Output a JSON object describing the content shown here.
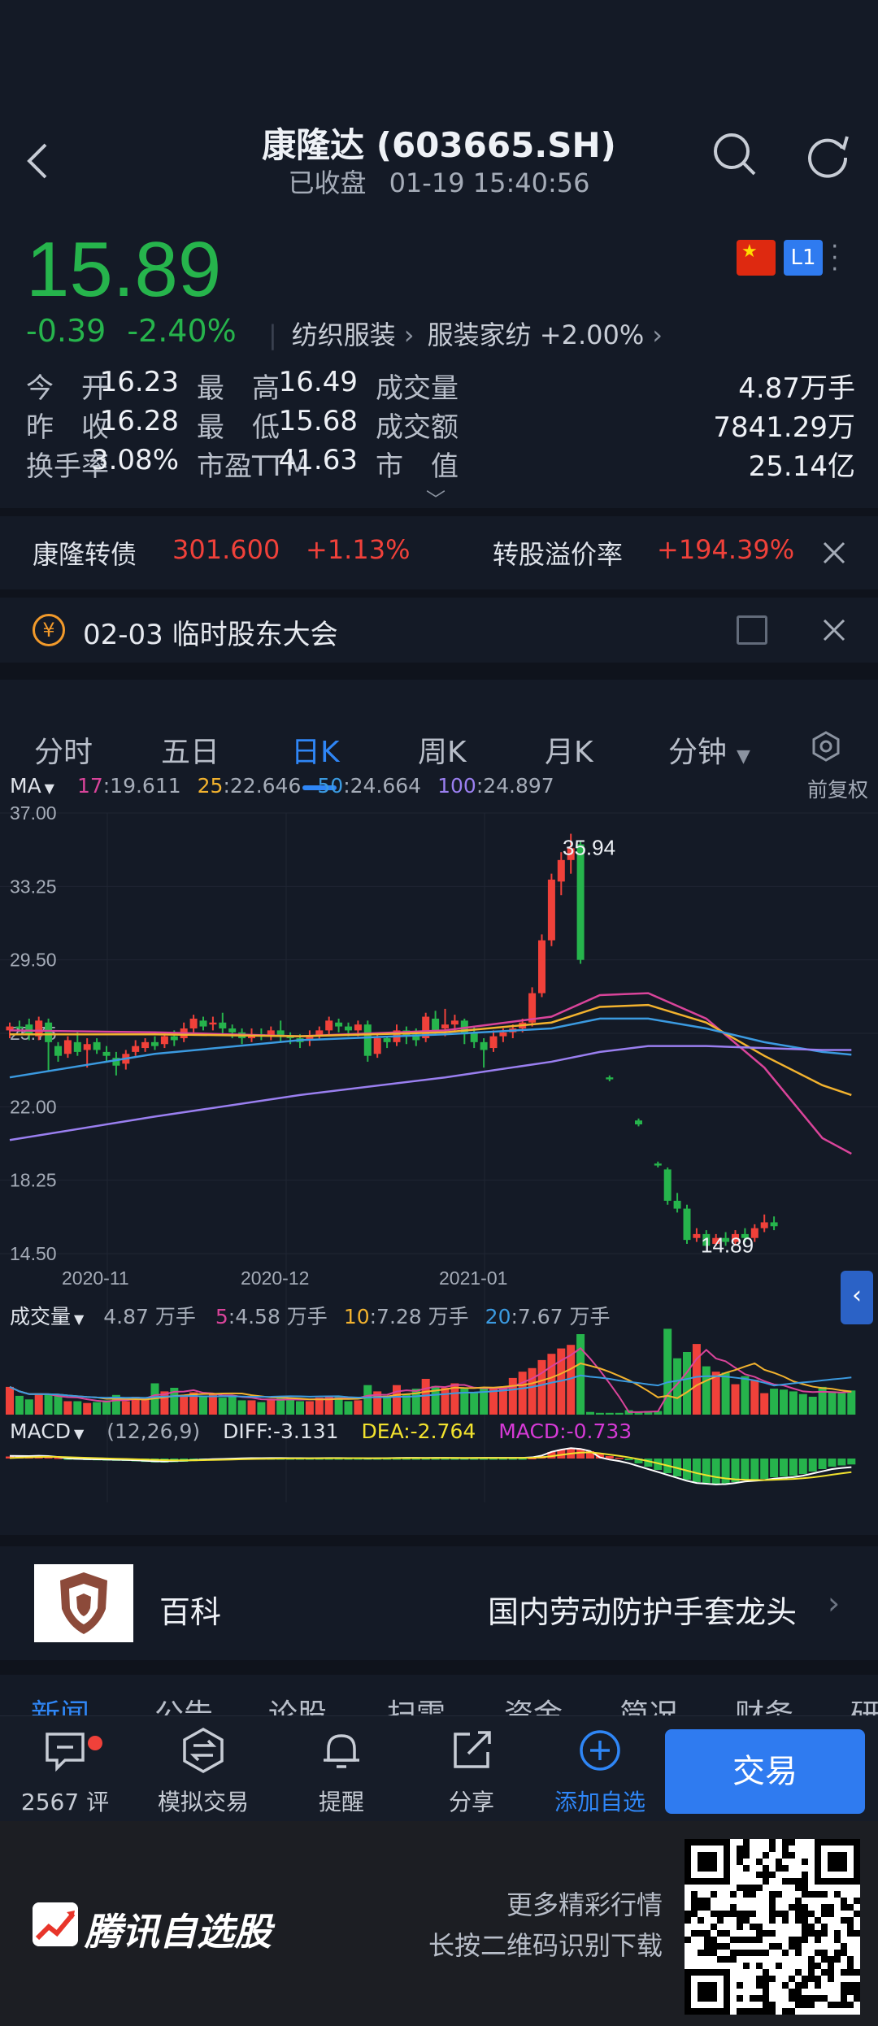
{
  "header": {
    "title": "康隆达 (603665.SH)",
    "status": "已收盘",
    "datetime": "01-19 15:40:56"
  },
  "quote": {
    "price": "15.89",
    "change": "-0.39",
    "change_pct": "-2.40%",
    "industry": "纺织服装",
    "subsector": "服装家纺",
    "subsector_change": "+2.00%",
    "level_badge": "L1",
    "stats": [
      {
        "label": "今　开",
        "value": "16.23"
      },
      {
        "label": "最　高",
        "value": "16.49"
      },
      {
        "label": "成交量",
        "value": "4.87万手"
      },
      {
        "label": "昨　收",
        "value": "16.28"
      },
      {
        "label": "最　低",
        "value": "15.68"
      },
      {
        "label": "成交额",
        "value": "7841.29万"
      },
      {
        "label": "换手率",
        "value": "3.08%"
      },
      {
        "label": "市盈TTM",
        "value": "41.63"
      },
      {
        "label": "市　值",
        "value": "25.14亿"
      }
    ]
  },
  "bond": {
    "name": "康隆转债",
    "price": "301.600",
    "change": "+1.13%",
    "premium_label": "转股溢价率",
    "premium_value": "+194.39%"
  },
  "event": {
    "coin": "¥",
    "text": "02-03 临时股东大会"
  },
  "tabs": {
    "items": [
      "分时",
      "五日",
      "日K",
      "周K",
      "月K",
      "分钟"
    ],
    "active": "日K"
  },
  "ma_legend": {
    "name": "MA",
    "items": [
      {
        "k": "17",
        "v": "19.611",
        "color": "#d9449a"
      },
      {
        "k": "25",
        "v": "22.646",
        "color": "#f2b22e"
      },
      {
        "k": "50",
        "v": "24.664",
        "color": "#3b9ae0"
      },
      {
        "k": "100",
        "v": "24.897",
        "color": "#9a7ff0"
      }
    ],
    "adjust": "前复权"
  },
  "volume_legend": {
    "name": "成交量",
    "current": "4.87 万手",
    "items": [
      {
        "k": "5",
        "v": "4.58 万手",
        "color": "#d9449a"
      },
      {
        "k": "10",
        "v": "7.28 万手",
        "color": "#f2b22e"
      },
      {
        "k": "20",
        "v": "7.67 万手",
        "color": "#3b9ae0"
      }
    ]
  },
  "macd_legend": {
    "name": "MACD",
    "params": "(12,26,9)",
    "diff": "DIFF:-3.131",
    "dea": "DEA:-2.764",
    "macd": "MACD:-0.733"
  },
  "chart_data": {
    "type": "candlestick",
    "y_ticks": [
      "37.00",
      "33.25",
      "29.50",
      "25.75",
      "22.00",
      "18.25",
      "14.50"
    ],
    "ylim": [
      14.5,
      37.0
    ],
    "x_ticks": [
      "2020-11",
      "2020-12",
      "2021-01"
    ],
    "high_label": "35.94",
    "low_label": "14.89",
    "candles": [
      [
        25.9,
        26.1,
        25.5,
        26.3
      ],
      [
        26.1,
        26.0,
        25.8,
        26.4
      ],
      [
        26.2,
        25.7,
        25.4,
        26.5
      ],
      [
        25.6,
        26.4,
        25.4,
        26.6
      ],
      [
        26.3,
        25.3,
        23.8,
        26.5
      ],
      [
        25.1,
        24.6,
        24.3,
        25.3
      ],
      [
        24.7,
        25.4,
        24.5,
        25.6
      ],
      [
        25.3,
        24.8,
        24.6,
        25.8
      ],
      [
        24.9,
        25.2,
        24.0,
        25.5
      ],
      [
        25.3,
        24.9,
        24.7,
        25.5
      ],
      [
        24.8,
        24.6,
        24.3,
        25.1
      ],
      [
        24.5,
        24.1,
        23.6,
        24.8
      ],
      [
        24.2,
        24.7,
        23.9,
        24.9
      ],
      [
        24.8,
        25.1,
        24.6,
        25.4
      ],
      [
        25.0,
        25.3,
        24.8,
        25.5
      ],
      [
        25.3,
        25.1,
        24.9,
        25.6
      ],
      [
        25.2,
        25.6,
        25.0,
        25.8
      ],
      [
        25.6,
        25.4,
        25.1,
        25.9
      ],
      [
        25.5,
        26.0,
        25.3,
        26.3
      ],
      [
        26.0,
        26.5,
        25.8,
        26.7
      ],
      [
        26.4,
        26.1,
        25.9,
        26.6
      ],
      [
        26.2,
        26.3,
        25.9,
        26.6
      ],
      [
        26.3,
        26.0,
        25.7,
        26.8
      ],
      [
        26.0,
        25.8,
        25.5,
        26.2
      ],
      [
        25.8,
        25.5,
        25.2,
        26.0
      ],
      [
        25.5,
        25.7,
        25.3,
        26.0
      ],
      [
        25.7,
        25.6,
        25.4,
        26.0
      ],
      [
        25.6,
        25.9,
        25.4,
        26.1
      ],
      [
        25.9,
        25.6,
        25.3,
        26.4
      ],
      [
        25.6,
        25.5,
        25.2,
        25.8
      ],
      [
        25.5,
        25.3,
        25.0,
        25.7
      ],
      [
        25.4,
        25.6,
        25.1,
        25.9
      ],
      [
        25.6,
        25.9,
        25.4,
        26.1
      ],
      [
        25.9,
        26.4,
        25.7,
        26.6
      ],
      [
        26.3,
        26.1,
        25.8,
        26.5
      ],
      [
        26.1,
        25.9,
        25.6,
        26.3
      ],
      [
        25.9,
        26.2,
        25.6,
        26.4
      ],
      [
        26.2,
        24.6,
        24.3,
        26.4
      ],
      [
        24.7,
        25.5,
        24.5,
        25.7
      ],
      [
        25.5,
        25.3,
        25.0,
        25.6
      ],
      [
        25.3,
        25.9,
        25.1,
        26.2
      ],
      [
        25.9,
        25.6,
        25.2,
        26.1
      ],
      [
        25.7,
        25.4,
        25.1,
        26.0
      ],
      [
        25.5,
        26.6,
        25.3,
        26.8
      ],
      [
        26.5,
        25.9,
        25.7,
        26.9
      ],
      [
        26.0,
        26.2,
        25.6,
        27.0
      ],
      [
        26.2,
        26.4,
        25.8,
        26.7
      ],
      [
        26.4,
        25.7,
        25.2,
        26.5
      ],
      [
        25.8,
        25.3,
        25.0,
        26.1
      ],
      [
        25.3,
        24.9,
        24.0,
        25.5
      ],
      [
        25.0,
        25.6,
        24.8,
        25.9
      ],
      [
        25.6,
        25.8,
        25.3,
        26.0
      ],
      [
        25.8,
        26.0,
        25.5,
        26.2
      ],
      [
        26.0,
        26.3,
        25.8,
        26.5
      ],
      [
        26.3,
        27.8,
        26.1,
        28.1
      ],
      [
        27.8,
        30.5,
        27.6,
        30.8
      ],
      [
        30.5,
        33.6,
        30.2,
        33.9
      ],
      [
        33.5,
        34.6,
        32.8,
        35.0
      ],
      [
        34.6,
        35.2,
        33.9,
        35.94
      ],
      [
        35.4,
        29.5,
        29.3,
        35.6
      ],
      [
        null
      ],
      [
        null
      ],
      [
        23.5,
        23.4,
        23.3,
        23.6
      ],
      [
        null
      ],
      [
        null
      ],
      [
        21.3,
        21.1,
        21.0,
        21.4
      ],
      [
        null
      ],
      [
        19.1,
        19.0,
        18.9,
        19.2
      ],
      [
        18.8,
        17.2,
        17.0,
        18.9
      ],
      [
        17.2,
        16.8,
        16.6,
        17.6
      ],
      [
        16.8,
        15.2,
        15.0,
        17.0
      ],
      [
        15.3,
        15.5,
        15.1,
        15.8
      ],
      [
        15.5,
        14.9,
        14.89,
        15.7
      ],
      [
        15.0,
        15.3,
        14.9,
        15.5
      ],
      [
        15.3,
        15.1,
        14.9,
        15.6
      ],
      [
        15.1,
        15.5,
        14.95,
        15.7
      ],
      [
        15.5,
        15.3,
        15.1,
        15.8
      ],
      [
        15.3,
        15.8,
        15.1,
        16.0
      ],
      [
        15.8,
        16.1,
        15.6,
        16.5
      ],
      [
        16.1,
        15.9,
        15.7,
        16.4
      ]
    ],
    "ma_series": [
      {
        "name": "MA17",
        "color": "#d9449a",
        "values": [
          [
            0,
            25.9
          ],
          [
            15,
            25.8
          ],
          [
            30,
            25.6
          ],
          [
            45,
            25.9
          ],
          [
            56,
            26.6
          ],
          [
            61,
            27.7
          ],
          [
            66,
            27.8
          ],
          [
            72,
            26.5
          ],
          [
            78,
            24.0
          ],
          [
            84,
            20.4
          ],
          [
            87,
            19.6
          ]
        ]
      },
      {
        "name": "MA25",
        "color": "#f2b22e",
        "values": [
          [
            0,
            25.7
          ],
          [
            15,
            25.7
          ],
          [
            30,
            25.6
          ],
          [
            45,
            25.8
          ],
          [
            56,
            26.3
          ],
          [
            61,
            27.1
          ],
          [
            66,
            27.2
          ],
          [
            72,
            26.3
          ],
          [
            78,
            24.6
          ],
          [
            84,
            23.1
          ],
          [
            87,
            22.6
          ]
        ]
      },
      {
        "name": "MA50",
        "color": "#3b9ae0",
        "values": [
          [
            0,
            23.5
          ],
          [
            15,
            24.7
          ],
          [
            30,
            25.4
          ],
          [
            45,
            25.7
          ],
          [
            56,
            26.0
          ],
          [
            61,
            26.5
          ],
          [
            66,
            26.5
          ],
          [
            72,
            26.0
          ],
          [
            78,
            25.3
          ],
          [
            84,
            24.8
          ],
          [
            87,
            24.66
          ]
        ]
      },
      {
        "name": "MA100",
        "color": "#9a7ff0",
        "values": [
          [
            0,
            20.3
          ],
          [
            15,
            21.5
          ],
          [
            30,
            22.6
          ],
          [
            45,
            23.5
          ],
          [
            56,
            24.3
          ],
          [
            61,
            24.8
          ],
          [
            66,
            25.1
          ],
          [
            72,
            25.1
          ],
          [
            78,
            25.0
          ],
          [
            84,
            24.9
          ],
          [
            87,
            24.9
          ]
        ]
      }
    ],
    "volume": [
      3.1,
      2.1,
      1.7,
      2.3,
      2.2,
      2.1,
      1.5,
      1.5,
      1.3,
      1.4,
      1.6,
      2.2,
      1.5,
      2.0,
      1.7,
      3.5,
      2.6,
      3.0,
      2.1,
      2.5,
      2.0,
      2.3,
      1.9,
      2.1,
      1.6,
      1.6,
      1.4,
      1.7,
      2.0,
      1.8,
      1.5,
      1.5,
      1.9,
      2.1,
      2.1,
      1.5,
      1.6,
      3.3,
      2.6,
      2.1,
      3.3,
      2.3,
      2.9,
      4.0,
      3.2,
      3.0,
      3.5,
      2.9,
      2.5,
      2.9,
      3.0,
      3.1,
      4.1,
      4.8,
      5.2,
      6.1,
      6.8,
      7.4,
      7.8,
      9.0,
      0.3,
      0.2,
      0.2,
      0.2,
      0.5,
      0.3,
      0.4,
      0.4,
      9.6,
      6.3,
      7.0,
      7.9,
      5.4,
      4.8,
      4.7,
      3.4,
      4.3,
      3.9,
      2.4,
      2.9,
      2.8,
      2.6,
      2.3,
      2.0,
      3.1,
      2.6,
      2.4,
      2.7
    ],
    "macd_hist": [
      0.25,
      0.24,
      0.22,
      0.26,
      0.22,
      0.1,
      -0.1,
      -0.15,
      -0.2,
      -0.22,
      -0.25,
      -0.28,
      -0.3,
      -0.35,
      -0.42,
      -0.48,
      -0.5,
      -0.45,
      -0.4,
      -0.32,
      -0.25,
      -0.2,
      -0.16,
      -0.12,
      -0.08,
      -0.06,
      -0.05,
      -0.04,
      -0.04,
      -0.05,
      -0.06,
      -0.07,
      -0.05,
      -0.04,
      -0.04,
      -0.05,
      -0.06,
      -0.08,
      -0.07,
      -0.05,
      -0.03,
      -0.02,
      -0.02,
      -0.03,
      -0.02,
      -0.02,
      -0.03,
      -0.04,
      -0.03,
      -0.02,
      -0.02,
      -0.01,
      -0.01,
      -0.01,
      0.05,
      0.3,
      0.8,
      1.1,
      1.3,
      1.2,
      0.9,
      0.6,
      0.3,
      0.1,
      -0.2,
      -0.6,
      -1.0,
      -1.4,
      -1.8,
      -2.2,
      -2.6,
      -2.9,
      -3.0,
      -3.1,
      -3.05,
      -2.9,
      -2.7,
      -2.6,
      -2.5,
      -2.3,
      -2.2,
      -2.1,
      -1.9,
      -1.6,
      -1.3,
      -1.0,
      -0.85,
      -0.73
    ]
  },
  "baike": {
    "label": "百科",
    "text": "国内劳动防护手套龙头"
  },
  "news_tabs": [
    "新闻",
    "公告",
    "论股",
    "扫雷",
    "资金",
    "简况",
    "财务",
    "研"
  ],
  "bottom_nav": [
    {
      "label": "2567 评",
      "icon": "comment-icon"
    },
    {
      "label": "模拟交易",
      "icon": "exchange-icon"
    },
    {
      "label": "提醒",
      "icon": "bell-icon"
    },
    {
      "label": "分享",
      "icon": "share-icon"
    },
    {
      "label": "添加自选",
      "icon": "plus-circle-icon"
    }
  ],
  "trade_button": "交易",
  "promo": {
    "brand": "腾讯自选股",
    "line1": "更多精彩行情",
    "line2": "长按二维码识别下载"
  }
}
